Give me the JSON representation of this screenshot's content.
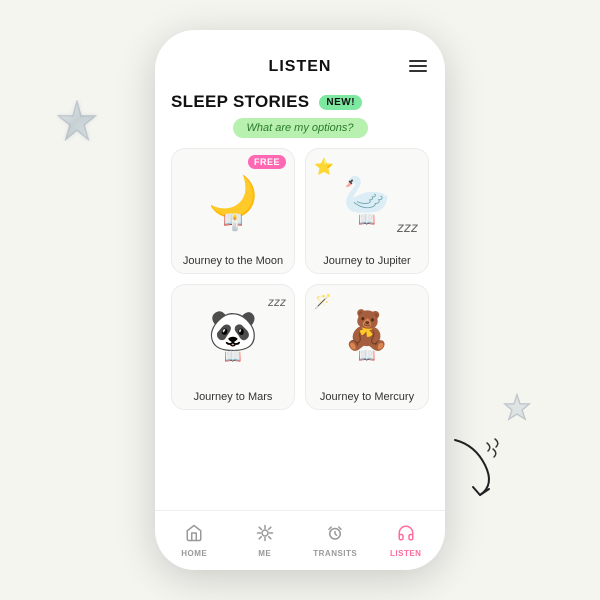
{
  "page": {
    "background": "#f5f5f0"
  },
  "header": {
    "title": "LISTEN",
    "hamburger_label": "menu"
  },
  "section": {
    "title": "SLEEP STORIES",
    "new_badge": "NEW!",
    "options_bubble": "What are my options?"
  },
  "stories": [
    {
      "id": "moon",
      "label": "Journey to the Moon",
      "badge": "FREE",
      "has_free_badge": true,
      "emoji_main": "🌙",
      "emoji_book": "📖"
    },
    {
      "id": "jupiter",
      "label": "Journey to Jupiter",
      "has_free_badge": false,
      "has_star": true,
      "has_zzz": true,
      "zzz_text": "zzz",
      "emoji_main": "🦢",
      "emoji_book": "📖"
    },
    {
      "id": "mars",
      "label": "Journey to Mars",
      "has_free_badge": false,
      "has_zzz": true,
      "zzz_text": "zzz",
      "emoji_main": "🐼",
      "emoji_book": "📖"
    },
    {
      "id": "mercury",
      "label": "Journey to Mercury",
      "has_free_badge": false,
      "has_wand": true,
      "emoji_main": "🧸",
      "emoji_book": "📖"
    }
  ],
  "nav": {
    "items": [
      {
        "id": "home",
        "label": "HOME",
        "icon": "home",
        "active": false
      },
      {
        "id": "me",
        "label": "ME",
        "icon": "sun",
        "active": false
      },
      {
        "id": "transits",
        "label": "TRANSITS",
        "icon": "alarm",
        "active": false
      },
      {
        "id": "listen",
        "label": "LISTEN",
        "icon": "headphones",
        "active": true
      }
    ]
  },
  "decorations": {
    "star_large": "✦",
    "star_small": "✦",
    "arrow_visible": true
  }
}
